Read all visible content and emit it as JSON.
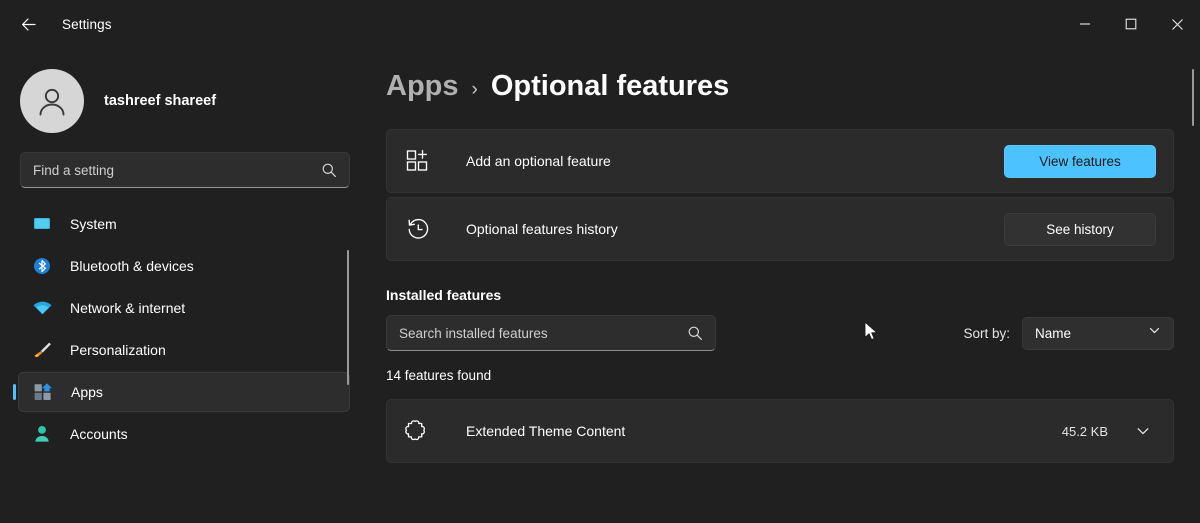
{
  "titlebar": {
    "back_icon": "back-arrow-icon",
    "title": "Settings",
    "minimize_label": "Minimize",
    "maximize_label": "Maximize",
    "close_label": "Close"
  },
  "sidebar": {
    "account": {
      "name": "tashreef shareef",
      "avatar_icon": "person-avatar-icon"
    },
    "search": {
      "placeholder": "Find a setting",
      "value": "",
      "icon": "search-icon"
    },
    "items": [
      {
        "label": "System",
        "icon": "monitor-icon",
        "selected": false
      },
      {
        "label": "Bluetooth & devices",
        "icon": "bluetooth-icon",
        "selected": false
      },
      {
        "label": "Network & internet",
        "icon": "wifi-icon",
        "selected": false
      },
      {
        "label": "Personalization",
        "icon": "paintbrush-icon",
        "selected": false
      },
      {
        "label": "Apps",
        "icon": "apps-icon",
        "selected": true
      },
      {
        "label": "Accounts",
        "icon": "account-person-icon",
        "selected": false
      }
    ]
  },
  "main": {
    "breadcrumb": {
      "parent": "Apps",
      "separator": "›",
      "current": "Optional features"
    },
    "cards": [
      {
        "icon": "add-grid-plus-icon",
        "label": "Add an optional feature",
        "button": "View features",
        "accent": true
      },
      {
        "icon": "history-clock-icon",
        "label": "Optional features history",
        "button": "See history",
        "accent": false
      }
    ],
    "installed": {
      "section_title": "Installed features",
      "search_placeholder": "Search installed features",
      "search_value": "",
      "search_icon": "search-icon",
      "sort_label": "Sort by:",
      "sort_value": "Name",
      "sort_chevron": "chevron-down-icon",
      "count_text": "14 features found",
      "rows": [
        {
          "icon": "puzzle-piece-icon",
          "name": "Extended Theme Content",
          "size": "45.2 KB",
          "chevron": "chevron-down-icon"
        }
      ]
    }
  },
  "colors": {
    "accent": "#4cc2ff",
    "window_bg": "#202020",
    "card_bg": "#2b2b2b",
    "selection_bg": "#2d2d2d"
  }
}
